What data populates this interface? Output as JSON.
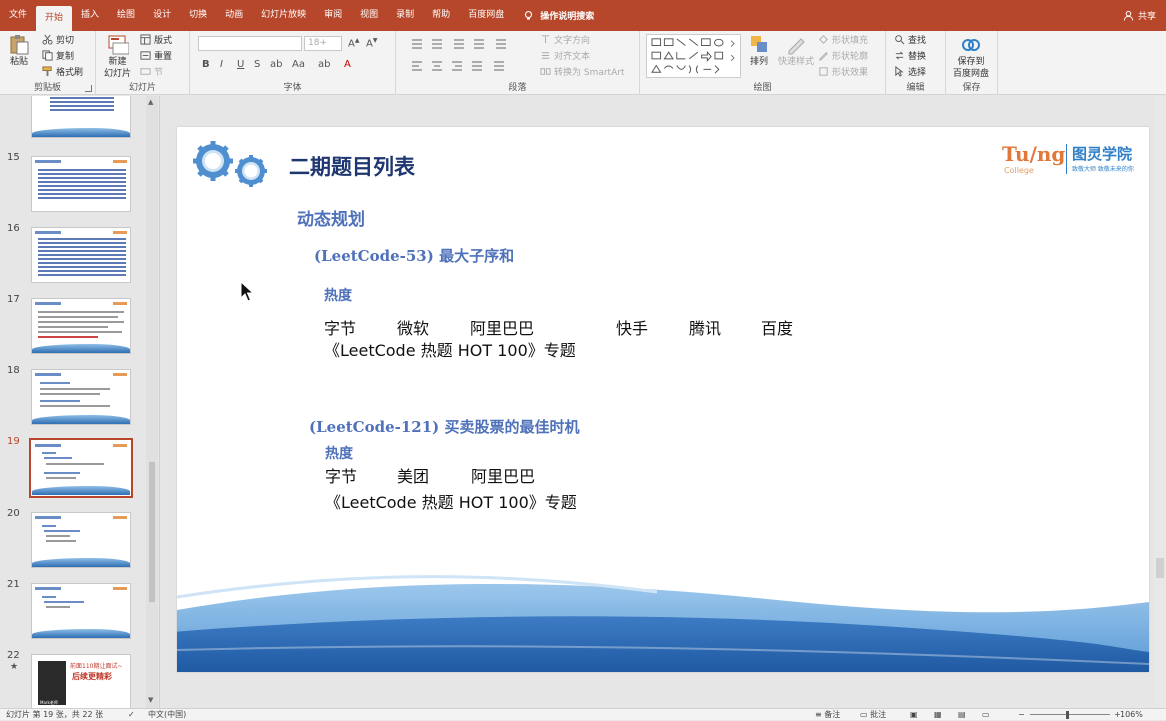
{
  "ribbon_tabs": {
    "file": "文件",
    "home": "开始",
    "insert": "插入",
    "draw": "绘图",
    "design": "设计",
    "transitions": "切换",
    "animations": "动画",
    "slideshow": "幻灯片放映",
    "review": "审阅",
    "view": "视图",
    "record": "录制",
    "help": "帮助",
    "baidu": "百度网盘",
    "tell_me": "操作说明搜索",
    "share": "共享"
  },
  "clipboard": {
    "paste": "粘贴",
    "cut": "剪切",
    "copy": "复制",
    "format_painter": "格式刷",
    "label": "剪贴板"
  },
  "slides_group": {
    "new_slide_line1": "新建",
    "new_slide_line2": "幻灯片",
    "layout": "版式",
    "reset": "重置",
    "section": "节",
    "label": "幻灯片"
  },
  "font_group": {
    "size": "18+",
    "label": "字体"
  },
  "paragraph_group": {
    "text_direction": "文字方向",
    "align_text": "对齐文本",
    "smartart": "转换为 SmartArt",
    "label": "段落"
  },
  "drawing_group": {
    "arrange": "排列",
    "quick_styles": "快速样式",
    "shape_fill": "形状填充",
    "shape_outline": "形状轮廓",
    "shape_effects": "形状效果",
    "label": "绘图"
  },
  "editing_group": {
    "find": "查找",
    "replace": "替换",
    "select": "选择",
    "label": "编辑"
  },
  "save_group": {
    "save_line1": "保存到",
    "save_line2": "百度网盘",
    "label": "保存"
  },
  "thumbnails": [
    {
      "num": "15"
    },
    {
      "num": "16"
    },
    {
      "num": "17"
    },
    {
      "num": "18"
    },
    {
      "num": "19"
    },
    {
      "num": "20"
    },
    {
      "num": "21"
    },
    {
      "num": "22",
      "star": "★"
    }
  ],
  "thumb22": {
    "line1": "前面110期让面试~",
    "line2": "后续更精彩",
    "name": "Mark老师"
  },
  "slide": {
    "title": "二期题目列表",
    "logo_brand": "Tu/ng",
    "logo_college": "College",
    "logo_cn": "图灵学院",
    "logo_tagline": "致敬大师 致敬未来的你",
    "section": "动态规划",
    "problems": [
      {
        "code": "(LeetCode-53)",
        "name": "最大子序和",
        "heat_label": "热度",
        "companies": [
          "字节",
          "微软",
          "阿里巴巴",
          "快手",
          "腾讯",
          "百度"
        ],
        "topic": "《LeetCode 热题 HOT 100》专题"
      },
      {
        "code": "(LeetCode-121)",
        "name": "买卖股票的最佳时机",
        "heat_label": "热度",
        "companies": [
          "字节",
          "美团",
          "阿里巴巴"
        ],
        "topic": "《LeetCode 热题 HOT 100》专题"
      }
    ]
  },
  "status": {
    "slide_info": "幻灯片 第 19 张，共 22 张",
    "language": "中文(中国)",
    "notes": "备注",
    "comments": "批注",
    "zoom": "106%"
  },
  "colors": {
    "accent": "#b7472a",
    "title": "#1f3770",
    "heading": "#4e71ba"
  }
}
